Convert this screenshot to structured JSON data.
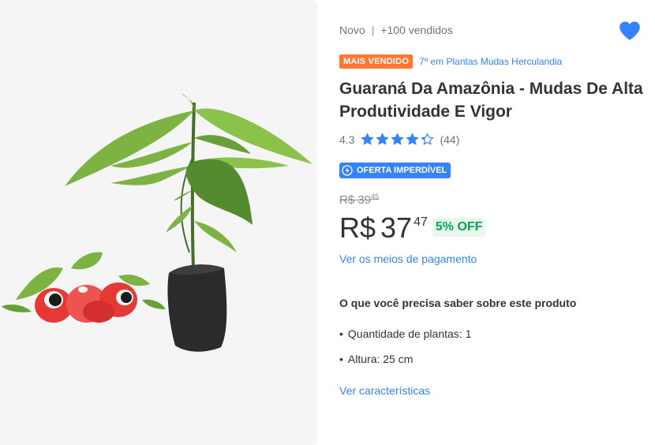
{
  "product": {
    "condition": "Novo",
    "separator": "|",
    "sold": "+100 vendidos",
    "best_seller_label": "MAIS VENDIDO",
    "ranking_link": "7º em Plantas Mudas Herculandia",
    "title": "Guaraná Da Amazônia - Mudas De Alta Produtividade E Vigor",
    "image_alt": "Muda de guaraná em saco com frutos de guaraná"
  },
  "rating": {
    "value": "4.3",
    "score": 4.3,
    "max": 5,
    "count": "(44)",
    "star_color": "#3483fa"
  },
  "deal": {
    "label": "OFERTA IMPERDÍVEL",
    "color": "#3483fa"
  },
  "price": {
    "old_currency": "R$",
    "old_amount": "39",
    "old_cents": "45",
    "currency": "R$",
    "amount": "37",
    "cents": "47",
    "discount": "5% OFF",
    "discount_color": "#00a650"
  },
  "links": {
    "payment": "Ver os meios de pagamento",
    "specs": "Ver características"
  },
  "features": {
    "title": "O que você precisa saber sobre este produto",
    "items": [
      "Quantidade de plantas: 1",
      "Altura: 25 cm"
    ]
  },
  "icons": {
    "favorite": "heart-icon",
    "deal": "lightning-badge-icon",
    "star": "star-icon"
  },
  "colors": {
    "accent": "#3483fa",
    "best_seller": "#ff7733",
    "image_bg": "#f5f5f5"
  }
}
